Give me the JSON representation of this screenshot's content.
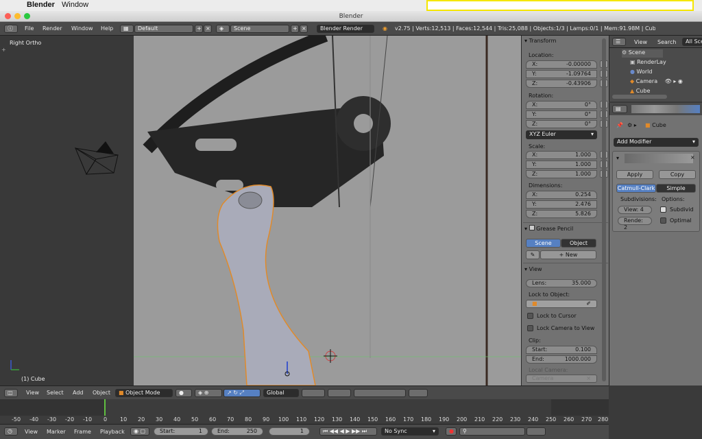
{
  "mac_menu": {
    "app": "Blender",
    "window": "Window"
  },
  "window_title": "Blender",
  "info_header": {
    "menus": [
      "File",
      "Render",
      "Window",
      "Help"
    ],
    "layout": "Default",
    "scene": "Scene",
    "engine": "Blender Render",
    "stats": "v2.75 | Verts:12,513 | Faces:12,544 | Tris:25,088 | Objects:1/3 | Lamps:0/1 | Mem:91.98M | Cube"
  },
  "viewport": {
    "view_name": "Right Ortho",
    "object_label": "(1) Cube"
  },
  "properties": {
    "transform_title": "Transform",
    "location_label": "Location:",
    "location": [
      {
        "axis": "X:",
        "value": "-0.00000"
      },
      {
        "axis": "Y:",
        "value": "-1.09764"
      },
      {
        "axis": "Z:",
        "value": "-0.43906"
      }
    ],
    "rotation_label": "Rotation:",
    "rotation": [
      {
        "axis": "X:",
        "value": "0°"
      },
      {
        "axis": "Y:",
        "value": "0°"
      },
      {
        "axis": "Z:",
        "value": "0°"
      }
    ],
    "rotation_mode": "XYZ Euler",
    "scale_label": "Scale:",
    "scale": [
      {
        "axis": "X:",
        "value": "1.000"
      },
      {
        "axis": "Y:",
        "value": "1.000"
      },
      {
        "axis": "Z:",
        "value": "1.000"
      }
    ],
    "dimensions_label": "Dimensions:",
    "dimensions": [
      {
        "axis": "X:",
        "value": "0.254"
      },
      {
        "axis": "Y:",
        "value": "2.476"
      },
      {
        "axis": "Z:",
        "value": "5.826"
      }
    ],
    "grease_title": "Grease Pencil",
    "grease_tabs": [
      "Scene",
      "Object"
    ],
    "grease_new": "New",
    "view_title": "View",
    "lens_label": "Lens:",
    "lens_value": "35.000",
    "lock_object_label": "Lock to Object:",
    "lock_cursor": "Lock to Cursor",
    "lock_camera": "Lock Camera to View",
    "clip_label": "Clip:",
    "clip_start_label": "Start:",
    "clip_start": "0.100",
    "clip_end_label": "End:",
    "clip_end": "1000.000",
    "local_camera_label": "Local Camera:",
    "local_camera_value": "Camera"
  },
  "outliner": {
    "menus": [
      "View",
      "Search",
      "All Sce"
    ],
    "items": [
      "Scene",
      "RenderLay",
      "World",
      "Camera",
      "Cube"
    ]
  },
  "modifier_panel": {
    "object": "Cube",
    "add_modifier": "Add Modifier",
    "apply": "Apply",
    "copy": "Copy",
    "tabs": [
      "Catmull-Clark",
      "Simple"
    ],
    "subdivisions_label": "Subdivisions:",
    "options_label": "Options:",
    "view_field": "View: 4",
    "render_field": "Rende: 2",
    "subdivid": "Subdivid",
    "optimal": "Optimal"
  },
  "view3d_header": {
    "menus": [
      "View",
      "Select",
      "Add",
      "Object"
    ],
    "mode": "Object Mode",
    "orientation": "Global"
  },
  "timeline": {
    "ticks": [
      "-50",
      "-40",
      "-30",
      "-20",
      "-10",
      "0",
      "10",
      "20",
      "30",
      "40",
      "50",
      "60",
      "70",
      "80",
      "90",
      "100",
      "110",
      "120",
      "130",
      "140",
      "150",
      "160",
      "170",
      "180",
      "190",
      "200",
      "210",
      "220",
      "230",
      "240",
      "250",
      "260",
      "270",
      "280"
    ],
    "current_frame": 0
  },
  "timeline_header": {
    "menus": [
      "View",
      "Marker",
      "Frame",
      "Playback"
    ],
    "start_label": "Start:",
    "start": "1",
    "end_label": "End:",
    "end": "250",
    "current": "1",
    "sync": "No Sync"
  }
}
